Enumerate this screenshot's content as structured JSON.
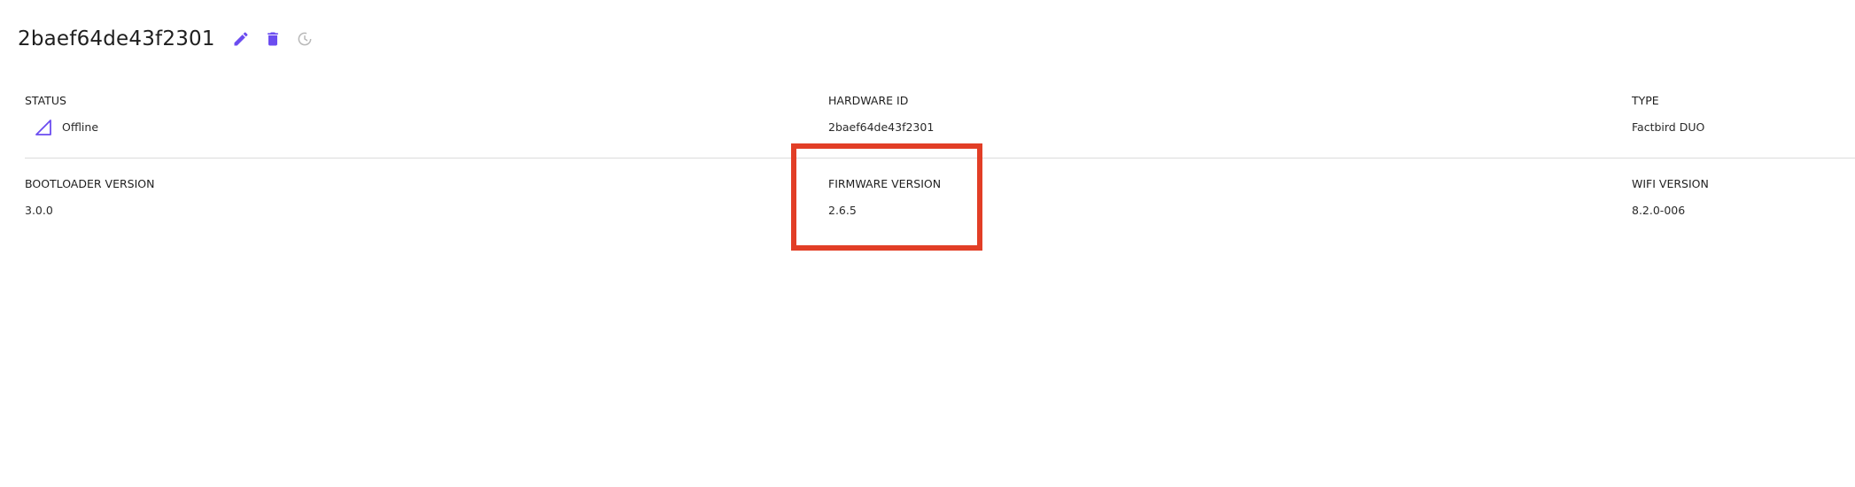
{
  "header": {
    "title": "2baef64de43f2301",
    "actions": {
      "edit_icon": "pencil-icon",
      "delete_icon": "trash-icon",
      "refresh_icon": "refresh-icon"
    }
  },
  "fields": {
    "status": {
      "label": "STATUS",
      "value": "Offline",
      "icon": "offline-signal-icon"
    },
    "hardware_id": {
      "label": "HARDWARE ID",
      "value": "2baef64de43f2301"
    },
    "type": {
      "label": "TYPE",
      "value": "Factbird DUO"
    },
    "bootloader_version": {
      "label": "BOOTLOADER VERSION",
      "value": "3.0.0"
    },
    "firmware_version": {
      "label": "FIRMWARE VERSION",
      "value": "2.6.5"
    },
    "wifi_version": {
      "label": "WIFI VERSION",
      "value": "8.2.0-006"
    }
  },
  "colors": {
    "accent": "#6b4cf0",
    "highlight": "#e23e26",
    "disabled_icon": "#b8b8b8",
    "divider": "#dcdcdc"
  }
}
